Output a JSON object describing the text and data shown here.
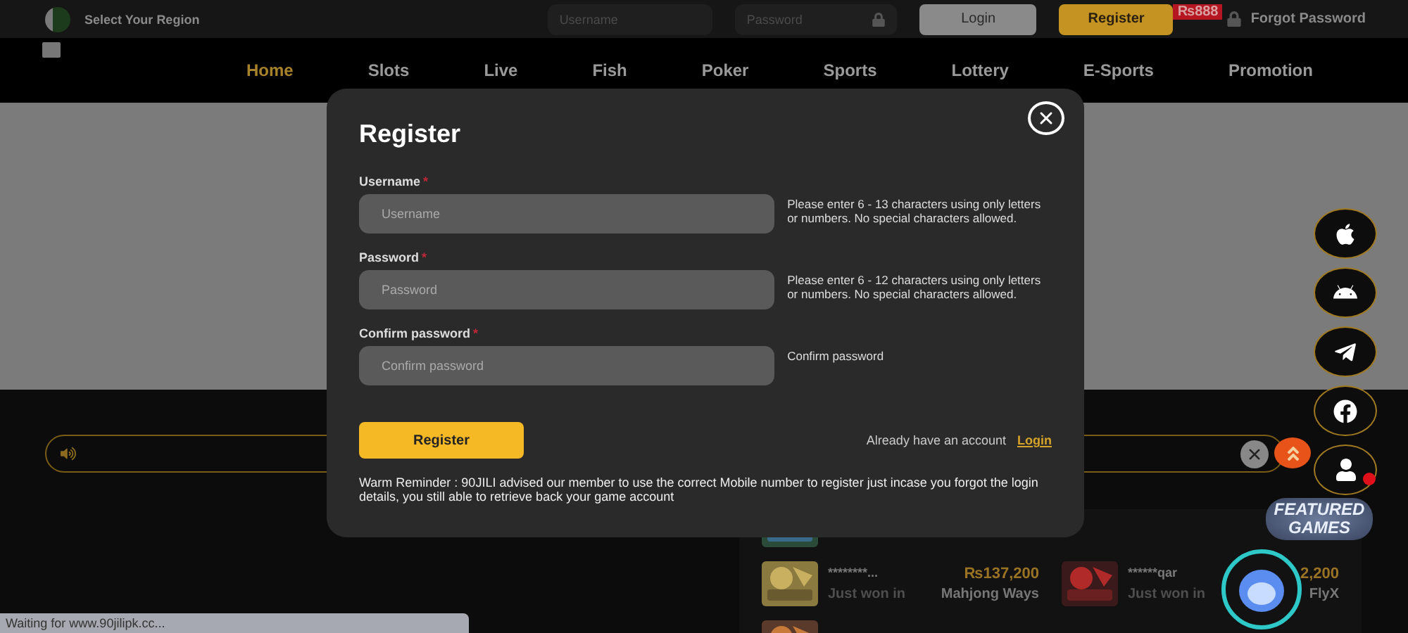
{
  "topbar": {
    "region_label": "Select Your Region",
    "username_placeholder": "Username",
    "password_placeholder": "Password",
    "login": "Login",
    "register": "Register",
    "register_badge": "₨888",
    "forgot_password": "Forgot Password"
  },
  "nav": [
    {
      "label": "Home",
      "selected": true
    },
    {
      "label": "Slots",
      "selected": false
    },
    {
      "label": "Live",
      "selected": false
    },
    {
      "label": "Fish",
      "selected": false
    },
    {
      "label": "Poker",
      "selected": false
    },
    {
      "label": "Sports",
      "selected": false
    },
    {
      "label": "Lottery",
      "selected": false
    },
    {
      "label": "E-Sports",
      "selected": false
    },
    {
      "label": "Promotion",
      "selected": false
    }
  ],
  "winners": [
    {
      "user": "********...",
      "caption": "Just won in",
      "amount": "₨137,200",
      "game": "Mahjong Ways"
    },
    {
      "user": "******qar",
      "caption": "Just won in",
      "amount": "2,200",
      "game": "FlyX"
    }
  ],
  "side_buttons": [
    {
      "kind": "apple"
    },
    {
      "kind": "android"
    },
    {
      "kind": "telegram"
    },
    {
      "kind": "facebook"
    },
    {
      "kind": "person",
      "alert": true
    }
  ],
  "featured": {
    "line_1": "FEATURED",
    "line_2": "GAMES"
  },
  "status_bar": "Waiting for www.90jilipk.cc...",
  "modal": {
    "title": "Register",
    "fields": [
      {
        "label": "Username",
        "required_mark": "*",
        "placeholder": "Username",
        "hint": "Please enter 6 - 13 characters using only letters or numbers. No special characters allowed."
      },
      {
        "label": "Password",
        "required_mark": "*",
        "placeholder": "Password",
        "hint": "Please enter 6 - 12 characters using only letters or numbers. No special characters allowed."
      },
      {
        "label": "Confirm password",
        "required_mark": "*",
        "placeholder": "Confirm password",
        "hint": "Confirm password"
      }
    ],
    "submit": "Register",
    "account_prompt": "Already have an account",
    "login_link": "Login",
    "reminder": "Warm Reminder : 90JILI advised our member to use the correct Mobile number to register just incase you forgot the login details, you still able to retrieve back your game account"
  }
}
